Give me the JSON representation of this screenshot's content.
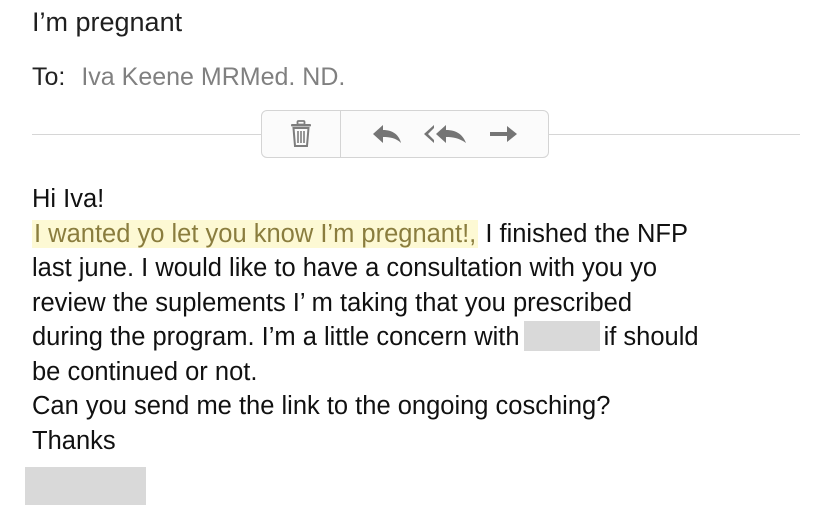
{
  "email": {
    "subject": "I’m pregnant",
    "to_label": "To:",
    "to_value": "Iva Keene MRMed. ND."
  },
  "toolbar": {
    "buttons": [
      {
        "icon": "trash-icon"
      },
      {
        "icon": "reply-icon"
      },
      {
        "icon": "reply-all-icon"
      },
      {
        "icon": "forward-icon"
      }
    ]
  },
  "message": {
    "greeting": "Hi Iva!",
    "highlight": "I wanted yo let you know I’m pregnant!,",
    "line1_rest": " I finished the NFP",
    "line2": "last june. I would like to have a consultation with you yo",
    "line3": "review the suplements  I’ m taking that you prescribed",
    "line4_before": "during the program. I’m a little concern with",
    "line4_after": "if should",
    "line5": "be continued or not.",
    "line6": "Can you send me the link to the ongoing cosching?",
    "closing": "Thanks"
  },
  "colors": {
    "highlight_bg": "#fdf9d4",
    "highlight_text": "#8a7d3e",
    "redaction": "#d9d9d9",
    "muted_text": "#808080"
  }
}
